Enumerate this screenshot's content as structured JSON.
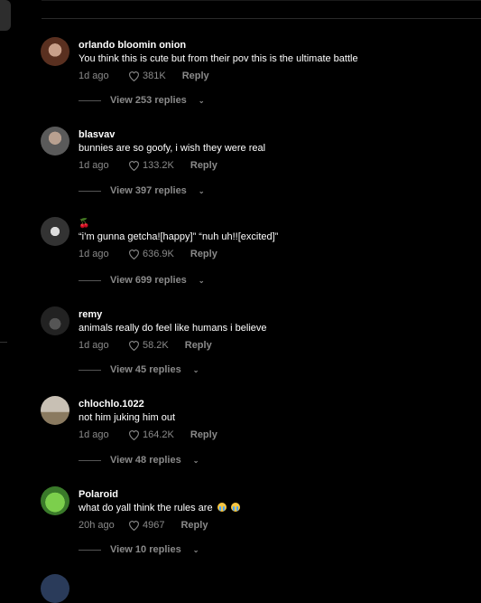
{
  "comments": [
    {
      "username": "orlando bloomin onion",
      "text": "You think this is cute but from their pov this is the ultimate battle",
      "time": "1d ago",
      "likes": "381K",
      "reply": "Reply",
      "view_replies": "View 253 replies",
      "avatar_color": "#8a5a4a"
    },
    {
      "username": "blasvav",
      "text": "bunnies are so goofy, i wish they were real",
      "time": "1d ago",
      "likes": "133.2K",
      "reply": "Reply",
      "view_replies": "View 397 replies",
      "avatar_color": "#6a6a6a"
    },
    {
      "username": "",
      "text": "“i’m gunna getcha![happy]” “nuh uh!![excited]”",
      "time": "1d ago",
      "likes": "636.9K",
      "reply": "Reply",
      "view_replies": "View 699 replies",
      "avatar_color": "#555555"
    },
    {
      "username": "remy",
      "text": "animals really do feel like humans i believe",
      "time": "1d ago",
      "likes": "58.2K",
      "reply": "Reply",
      "view_replies": "View 45 replies",
      "avatar_color": "#3a3a3a"
    },
    {
      "username": "chlochlo.1022",
      "text": "not him juking him out",
      "time": "1d ago",
      "likes": "164.2K",
      "reply": "Reply",
      "view_replies": "View 48 replies",
      "avatar_color": "#9a8a7a"
    },
    {
      "username": "Polaroid",
      "text": "what do yall think the rules are",
      "time": "20h ago",
      "likes": "4967",
      "reply": "Reply",
      "view_replies": "View 10 replies",
      "avatar_color": "#5cb85c"
    }
  ],
  "emoji": {
    "cherry": "cherry-emoji",
    "crying": "loudly-crying-emoji"
  }
}
